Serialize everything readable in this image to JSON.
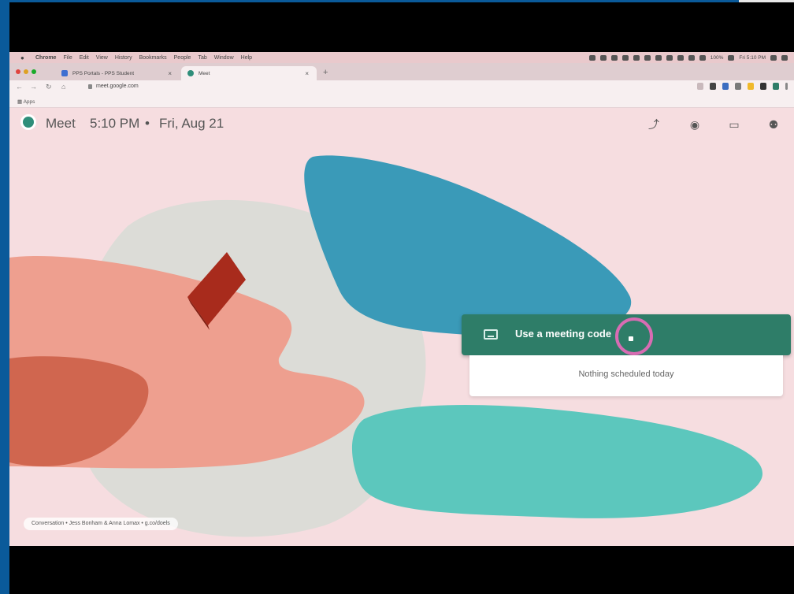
{
  "menubar": {
    "items": [
      "Chrome",
      "File",
      "Edit",
      "View",
      "History",
      "Bookmarks",
      "People",
      "Tab",
      "Window",
      "Help"
    ],
    "battery": "100%",
    "clock": "Fri 5:10 PM"
  },
  "tabs": [
    {
      "label": "PPS Portals - PPS Student",
      "favicon_color": "#3d6fd1"
    },
    {
      "label": "Meet",
      "favicon_color": "#2f8e7a"
    }
  ],
  "address": {
    "url": "meet.google.com"
  },
  "bookmarks": {
    "apps_label": "Apps"
  },
  "meet": {
    "title": "Meet",
    "time": "5:10 PM",
    "separator": "•",
    "date": "Fri, Aug 21",
    "header_icons": [
      "trend-icon",
      "help-icon",
      "feedback-icon",
      "avatar-icon"
    ]
  },
  "meeting": {
    "button_label": "Use a meeting code",
    "schedule_empty": "Nothing scheduled today"
  },
  "credit": {
    "text": "Conversation • Jess Bonham & Anna Lomax • g.co/doels"
  },
  "colors": {
    "meet_green": "#2e7d68",
    "background": "#f6dde0",
    "blue_blob": "#3a9ab8",
    "teal_blob": "#5cc7bd",
    "salmon_blob": "#ee9f8f",
    "orange_blob": "#d0664f",
    "gray_blob": "#dcdcd7",
    "red_block": "#a82b1c",
    "cursor_ring": "#d86cb3"
  }
}
